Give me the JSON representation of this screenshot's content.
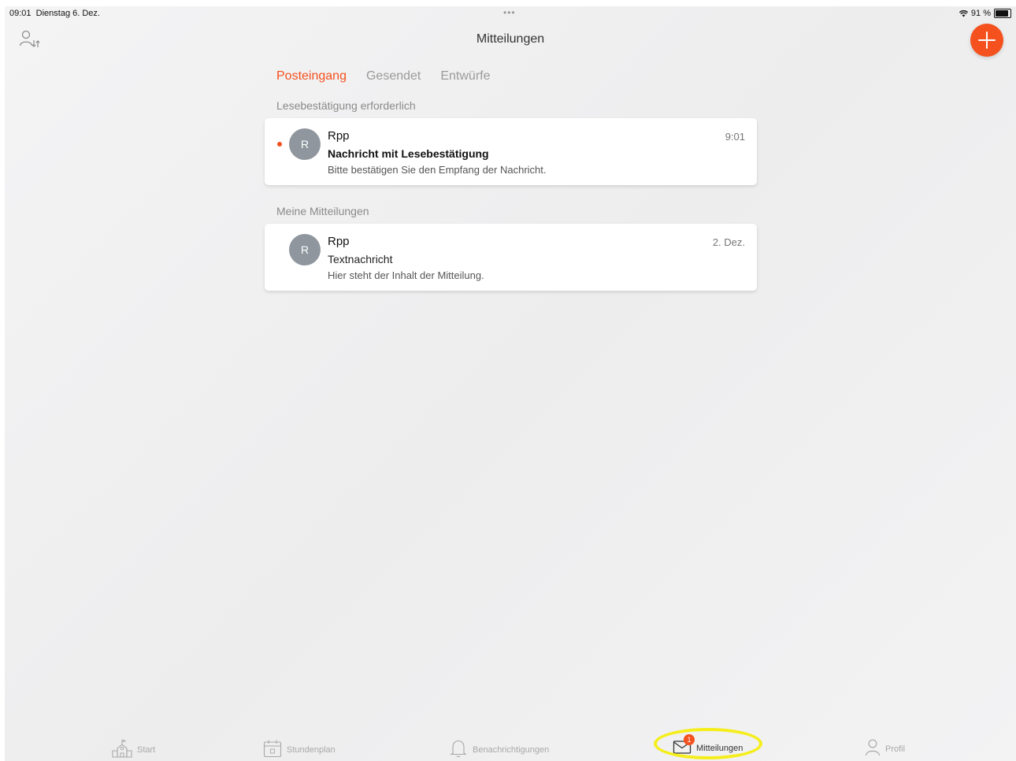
{
  "status_bar": {
    "time": "09:01",
    "date": "Dienstag 6. Dez.",
    "center_dots": "•••",
    "battery_text": "91 %",
    "battery_level_percent": 91
  },
  "header": {
    "title": "Mitteilungen"
  },
  "tabs": [
    {
      "label": "Posteingang",
      "active": true
    },
    {
      "label": "Gesendet",
      "active": false
    },
    {
      "label": "Entwürfe",
      "active": false
    }
  ],
  "sections": [
    {
      "label": "Lesebestätigung erforderlich",
      "messages": [
        {
          "avatar_initial": "R",
          "sender": "Rpp",
          "subject": "Nachricht mit Lesebestätigung",
          "preview": "Bitte bestätigen Sie den Empfang der Nachricht.",
          "time": "9:01",
          "unread": true
        }
      ]
    },
    {
      "label": "Meine Mitteilungen",
      "messages": [
        {
          "avatar_initial": "R",
          "sender": "Rpp",
          "subject": "Textnachricht",
          "preview": "Hier steht der Inhalt der Mitteilung.",
          "time": "2. Dez.",
          "unread": false
        }
      ]
    }
  ],
  "tab_bar": {
    "items": [
      {
        "label": "Start",
        "icon": "school-icon"
      },
      {
        "label": "Stundenplan",
        "icon": "calendar-icon"
      },
      {
        "label": "Benachrichtigungen",
        "icon": "bell-icon"
      },
      {
        "label": "Mitteilungen",
        "icon": "envelope-icon",
        "badge": "1"
      },
      {
        "label": "Profil",
        "icon": "person-icon"
      }
    ]
  },
  "colors": {
    "accent": "#f4511e",
    "highlight": "#f5ee1a",
    "avatar": "#8f969e"
  }
}
